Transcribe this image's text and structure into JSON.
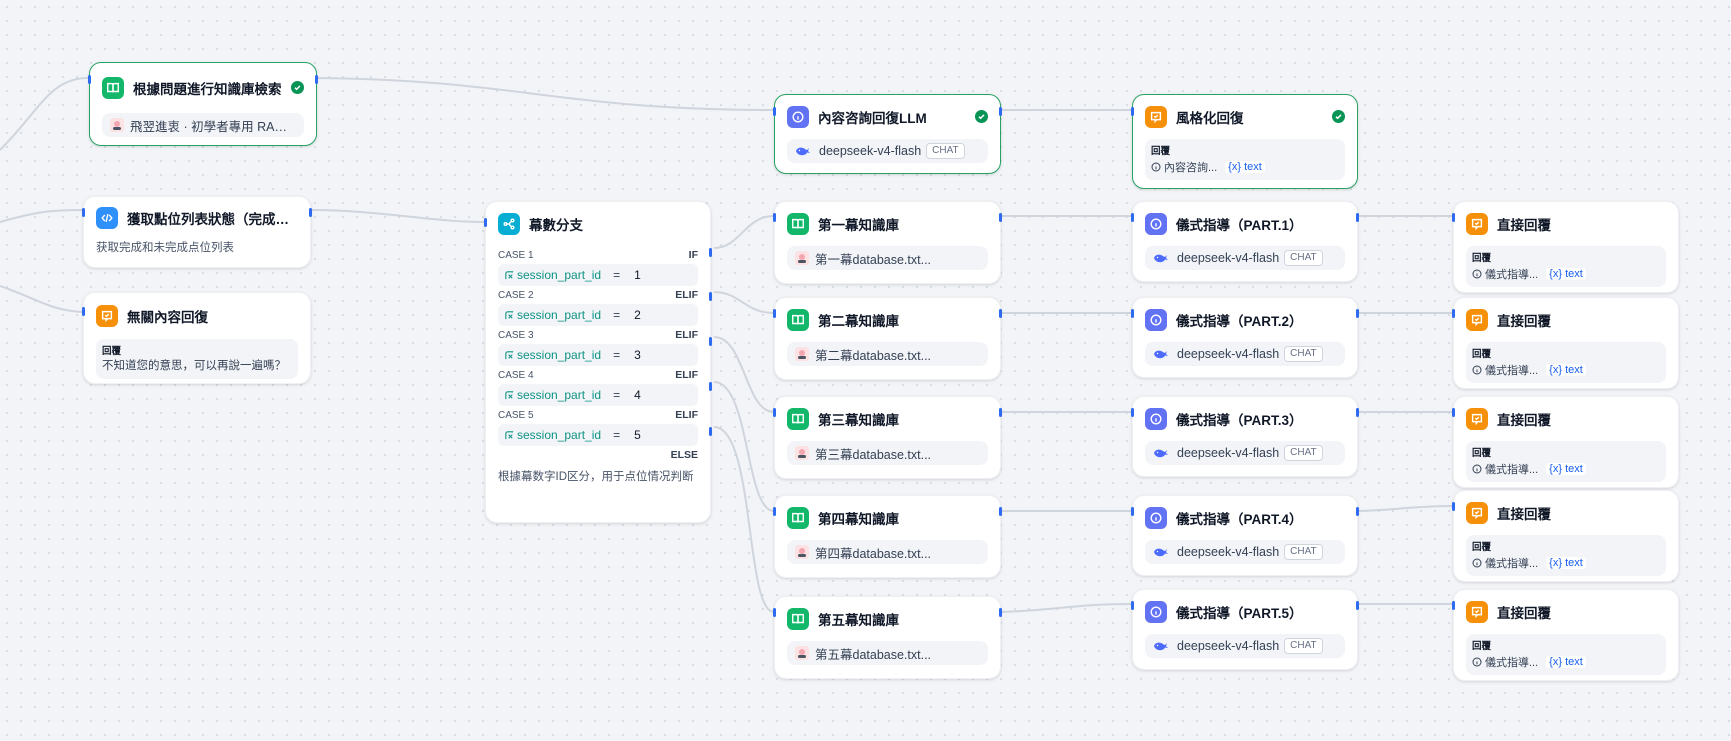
{
  "nodes": {
    "kb_search": {
      "title": "根據問題進行知識庫檢索",
      "dataset": "飛翌進衷 · 初學者專用 RAG 知識..."
    },
    "fetch": {
      "title": "獲取點位列表狀態（完成和...",
      "desc": "获取完成和未完成点位列表"
    },
    "irrelevant": {
      "title": "無關內容回復",
      "label": "回覆",
      "text": "不知道您的意思，可以再說一遍嗎？"
    },
    "llm_main": {
      "title": "內容咨詢回復LLM",
      "model": "deepseek-v4-flash",
      "badge": "CHAT"
    },
    "style_reply": {
      "title": "風格化回復",
      "label": "回覆",
      "var": "內容咨詢...",
      "var_suffix": "{x} text"
    },
    "branch": {
      "title": "幕數分支",
      "cases": [
        {
          "label": "CASE 1",
          "kw": "IF",
          "var": "session_part_id",
          "op": "=",
          "val": "1"
        },
        {
          "label": "CASE 2",
          "kw": "ELIF",
          "var": "session_part_id",
          "op": "=",
          "val": "2"
        },
        {
          "label": "CASE 3",
          "kw": "ELIF",
          "var": "session_part_id",
          "op": "=",
          "val": "3"
        },
        {
          "label": "CASE 4",
          "kw": "ELIF",
          "var": "session_part_id",
          "op": "=",
          "val": "4"
        },
        {
          "label": "CASE 5",
          "kw": "ELIF",
          "var": "session_part_id",
          "op": "=",
          "val": "5"
        }
      ],
      "else": "ELSE",
      "desc": "根據幕数字ID区分，用于点位情况判断"
    },
    "kbs": [
      {
        "title": "第一幕知識庫",
        "dataset": "第一幕database.txt..."
      },
      {
        "title": "第二幕知識庫",
        "dataset": "第二幕database.txt..."
      },
      {
        "title": "第三幕知識庫",
        "dataset": "第三幕database.txt..."
      },
      {
        "title": "第四幕知識庫",
        "dataset": "第四幕database.txt..."
      },
      {
        "title": "第五幕知識庫",
        "dataset": "第五幕database.txt..."
      }
    ],
    "llms": [
      {
        "title": "儀式指導（PART.1）",
        "model": "deepseek-v4-flash",
        "badge": "CHAT"
      },
      {
        "title": "儀式指導（PART.2）",
        "model": "deepseek-v4-flash",
        "badge": "CHAT"
      },
      {
        "title": "儀式指導（PART.3）",
        "model": "deepseek-v4-flash",
        "badge": "CHAT"
      },
      {
        "title": "儀式指導（PART.4）",
        "model": "deepseek-v4-flash",
        "badge": "CHAT"
      },
      {
        "title": "儀式指導（PART.5）",
        "model": "deepseek-v4-flash",
        "badge": "CHAT"
      }
    ],
    "answers": [
      {
        "title": "直接回覆",
        "label": "回覆",
        "var": "儀式指導...",
        "var_suffix": "{x} text"
      },
      {
        "title": "直接回覆",
        "label": "回覆",
        "var": "儀式指導...",
        "var_suffix": "{x} text"
      },
      {
        "title": "直接回覆",
        "label": "回覆",
        "var": "儀式指導...",
        "var_suffix": "{x} text"
      },
      {
        "title": "直接回覆",
        "label": "回覆",
        "var": "儀式指導...",
        "var_suffix": "{x} text"
      },
      {
        "title": "直接回覆",
        "label": "回覆",
        "var": "儀式指導...",
        "var_suffix": "{x} text"
      }
    ]
  },
  "colors": {
    "knowledge": "#12b76a",
    "code": "#2e90fa",
    "answer": "#f79009",
    "llm": "#6172f3",
    "branch": "#06aed4",
    "edge": "#d0d5dd",
    "selected": "#27a263"
  }
}
